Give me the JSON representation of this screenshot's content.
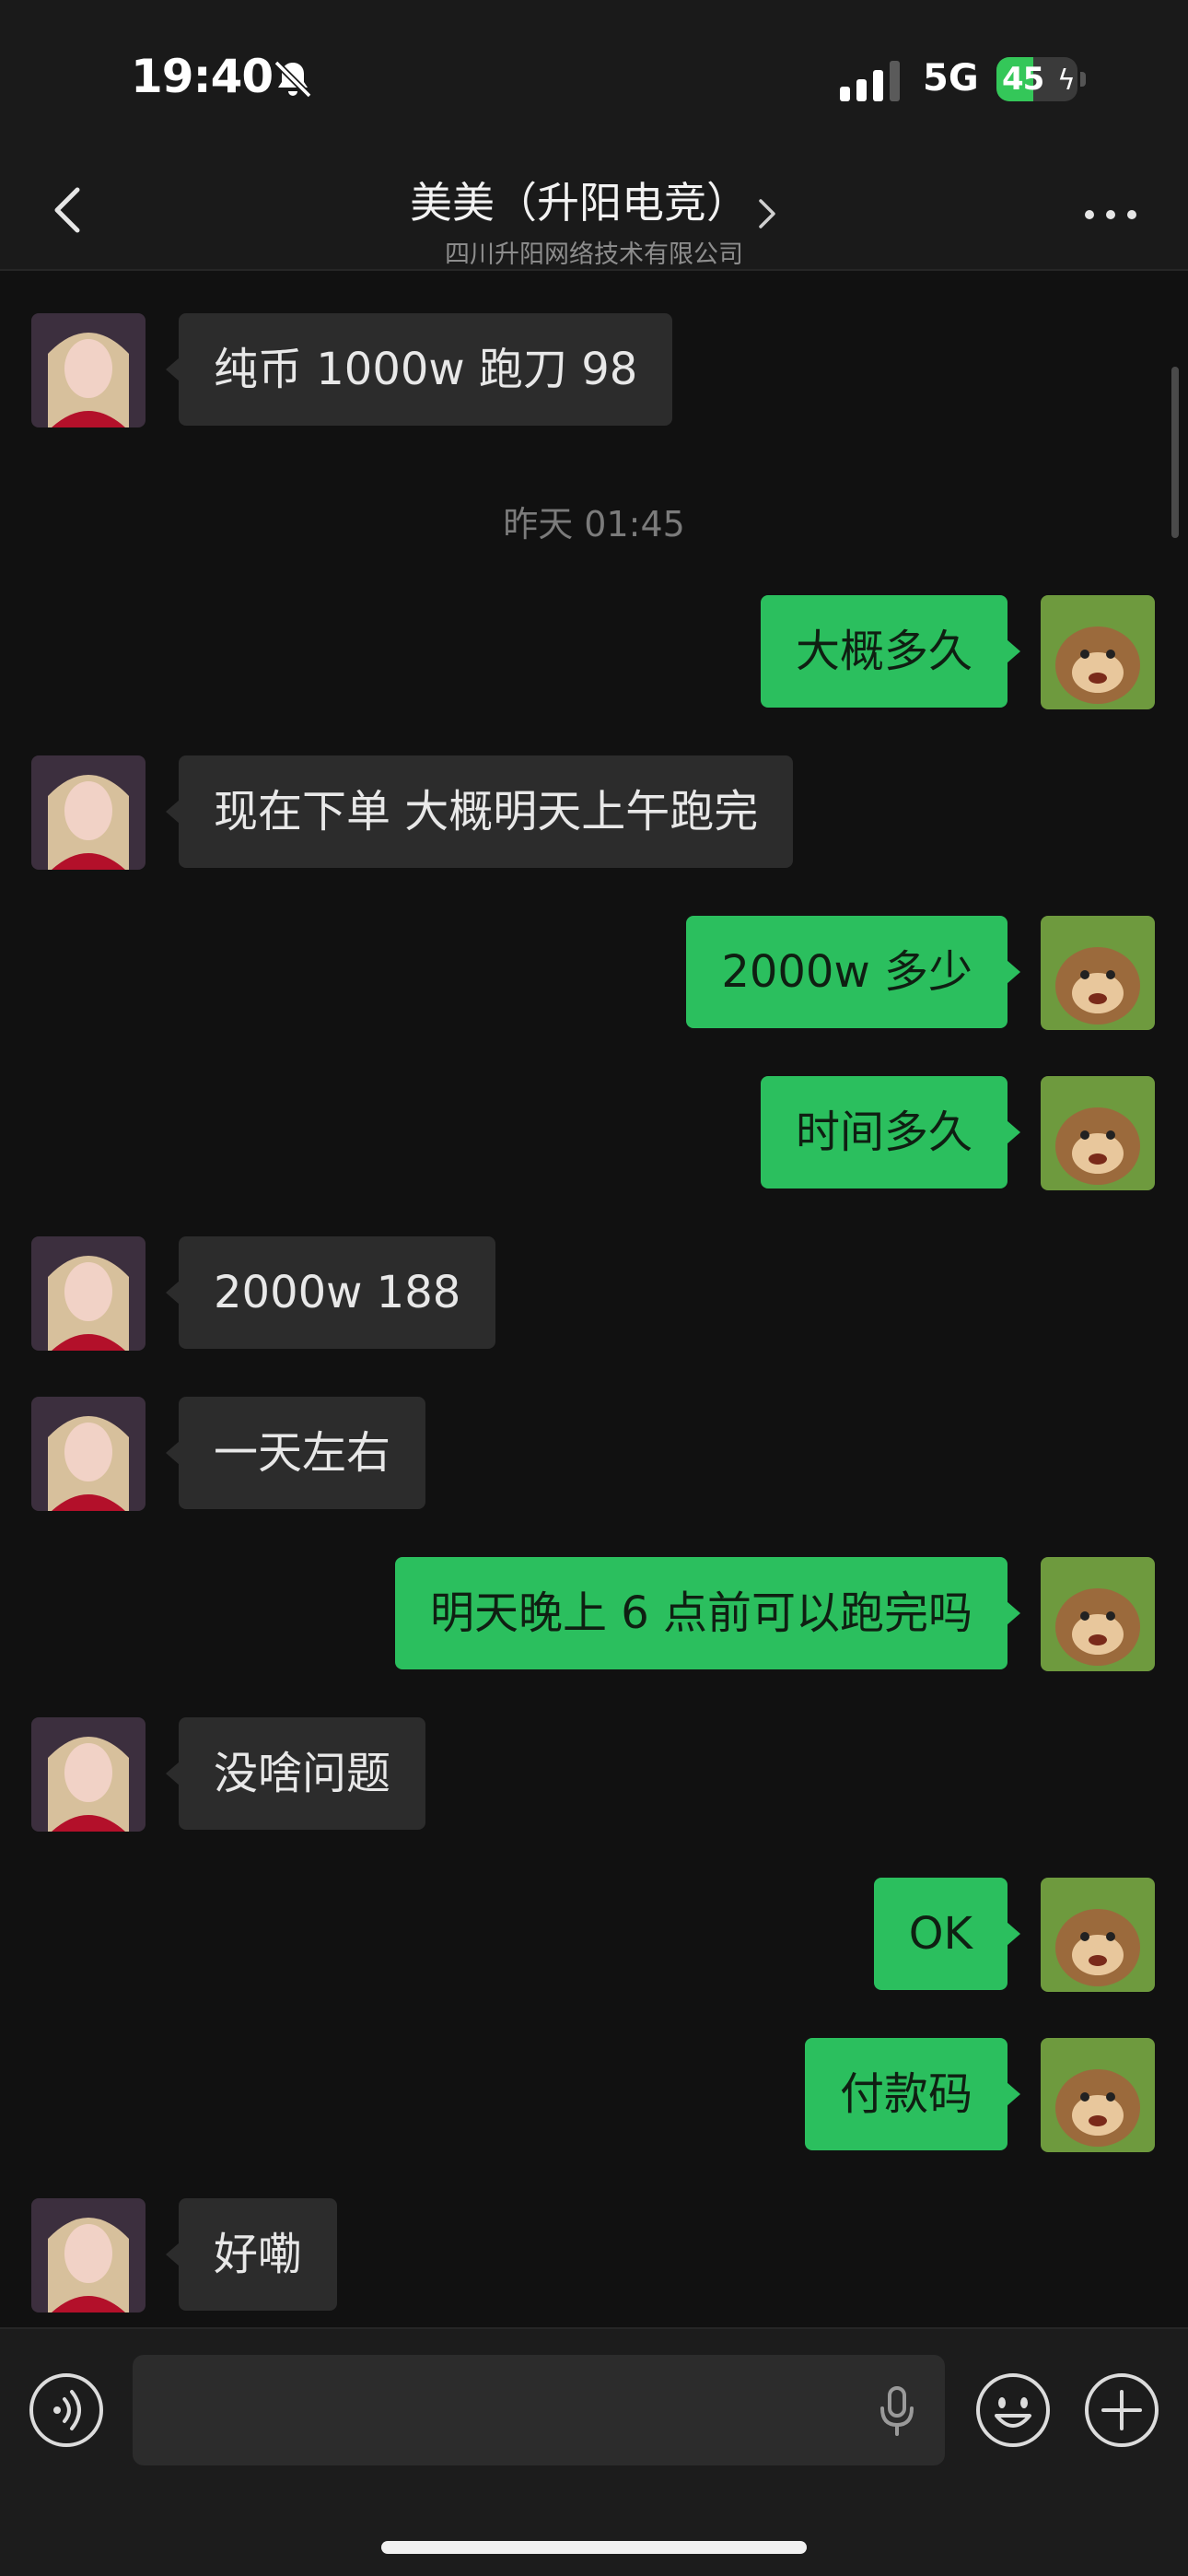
{
  "status_bar": {
    "time": "19:40",
    "network": "5G",
    "battery_percent": "45",
    "battery_level": 0.45,
    "icons": [
      "bell-slash-icon",
      "signal-bars-icon",
      "battery-charging-icon"
    ]
  },
  "header": {
    "title": "美美（升阳电竞）",
    "subtitle": "四川升阳网络技术有限公司",
    "icons": [
      "chevron-left-icon",
      "chevron-right-icon",
      "more-dots-icon"
    ]
  },
  "messages": [
    {
      "from": "them",
      "text": "纯币 1000w 跑刀 98"
    },
    {
      "type": "time",
      "text": "昨天 01:45"
    },
    {
      "from": "me",
      "text": "大概多久"
    },
    {
      "from": "them",
      "text": "现在下单 大概明天上午跑完"
    },
    {
      "from": "me",
      "text": "2000w 多少"
    },
    {
      "from": "me",
      "text": "时间多久"
    },
    {
      "from": "them",
      "text": "2000w 188"
    },
    {
      "from": "them",
      "text": "一天左右"
    },
    {
      "from": "me",
      "text": "明天晚上 6 点前可以跑完吗"
    },
    {
      "from": "them",
      "text": "没啥问题"
    },
    {
      "from": "me",
      "text": "OK"
    },
    {
      "from": "me",
      "text": "付款码"
    },
    {
      "from": "them",
      "text": "好嘞"
    }
  ],
  "input_bar": {
    "value": "",
    "icons": [
      "voice-mode-icon",
      "microphone-icon",
      "emoji-icon",
      "plus-icon"
    ]
  },
  "colors": {
    "background": "#111111",
    "incoming_bubble": "#2c2c2c",
    "outgoing_bubble": "#2bbf5e",
    "battery_green": "#34c759"
  }
}
